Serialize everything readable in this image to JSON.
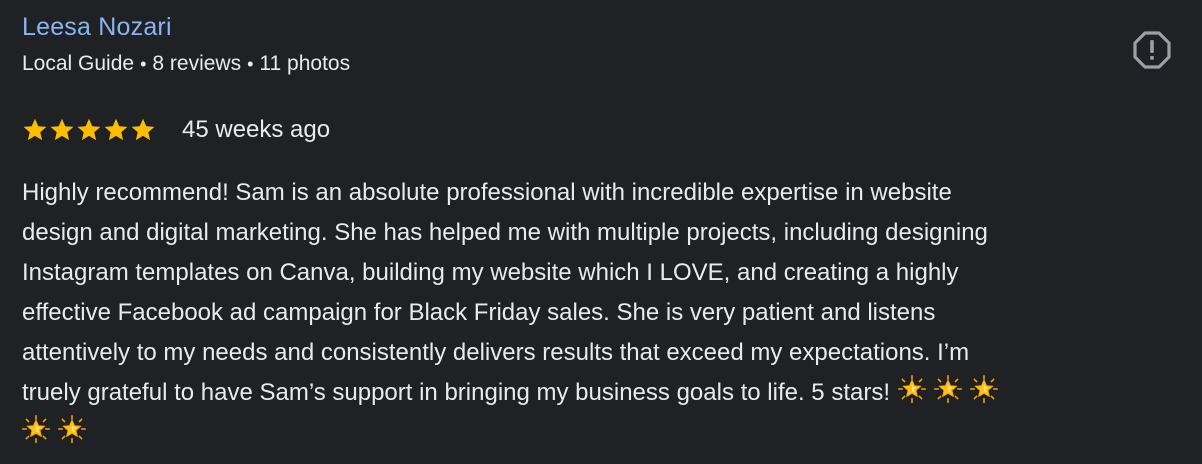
{
  "reviewer": {
    "name": "Leesa Nozari",
    "badge": "Local Guide",
    "reviews_count": "8 reviews",
    "photos_count": "11 photos",
    "separator": "•"
  },
  "review": {
    "rating": 5,
    "rating_max": 5,
    "age": "45 weeks ago",
    "text_lines": [
      "Highly recommend! Sam is an absolute professional with incredible expertise in website",
      "design and digital marketing. She has helped me with multiple projects, including designing",
      "Instagram templates on Canva, building my website which I LOVE, and creating a highly",
      "effective Facebook ad campaign for Black Friday sales. She is very patient and listens",
      "attentively to my needs and consistently delivers results that exceed my expectations. I’m",
      "truely grateful to have Sam’s support in bringing my business goals to life. 5 stars!"
    ],
    "emoji_count": 5,
    "emoji_icon": "glowing-star-icon"
  },
  "actions": {
    "report_icon": "report-alert-icon"
  },
  "colors": {
    "background": "#202124",
    "name_link": "#8ab4f8",
    "text": "#e8eaed",
    "star": "#fbbc04",
    "icon": "#9aa0a6"
  }
}
